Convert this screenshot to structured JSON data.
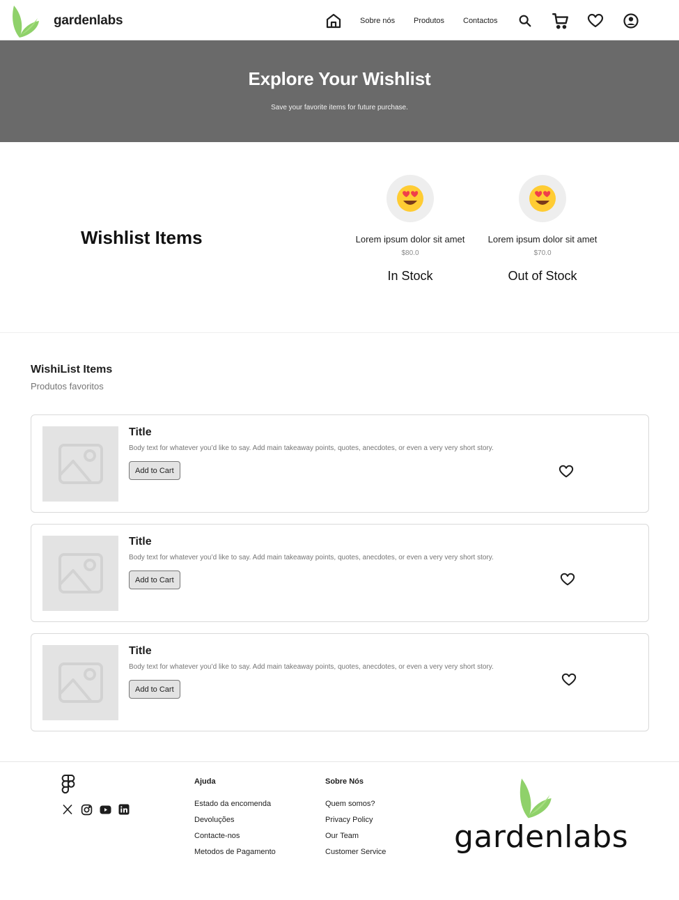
{
  "nav": {
    "brand": "gardenlabs",
    "links": [
      "Sobre nós",
      "Produtos",
      "Contactos"
    ]
  },
  "hero": {
    "title": "Explore Your Wishlist",
    "subtitle": "Save your favorite items for future purchase."
  },
  "summary": {
    "title": "Wishlist Items",
    "items": [
      {
        "name": "Lorem ipsum dolor sit amet",
        "price": "$80.0",
        "stock": "In Stock"
      },
      {
        "name": "Lorem ipsum dolor sit amet",
        "price": "$70.0",
        "stock": "Out of Stock"
      }
    ]
  },
  "list": {
    "heading": "WishiList Items",
    "subheading": "Produtos favoritos",
    "cards": [
      {
        "title": "Title",
        "body": "Body text for whatever you’d like to say. Add main takeaway points, quotes, anecdotes, or even a very very short story.",
        "button": "Add to Cart"
      },
      {
        "title": "Title",
        "body": "Body text for whatever you’d like to say. Add main takeaway points, quotes, anecdotes, or even a very very short story.",
        "button": "Add to Cart"
      },
      {
        "title": "Title",
        "body": "Body text for whatever you’d like to say. Add main takeaway points, quotes, anecdotes, or even a very very short story.",
        "button": "Add to Cart"
      }
    ]
  },
  "footer": {
    "col1": {
      "heading": "Ajuda",
      "links": [
        "Estado da encomenda",
        "Devoluções",
        "Contacte-nos",
        "Metodos de Pagamento"
      ]
    },
    "col2": {
      "heading": "Sobre Nós",
      "links": [
        "Quem somos?",
        "Privacy Policy",
        "Our Team",
        "Customer Service"
      ]
    },
    "brand": "gardenlabs",
    "socials": [
      "x-icon",
      "instagram-icon",
      "youtube-icon",
      "linkedin-icon"
    ]
  },
  "colors": {
    "brand_green": "#8fd16a",
    "hero_bg": "#6a6a6a",
    "placeholder": "#e3e3e3"
  }
}
